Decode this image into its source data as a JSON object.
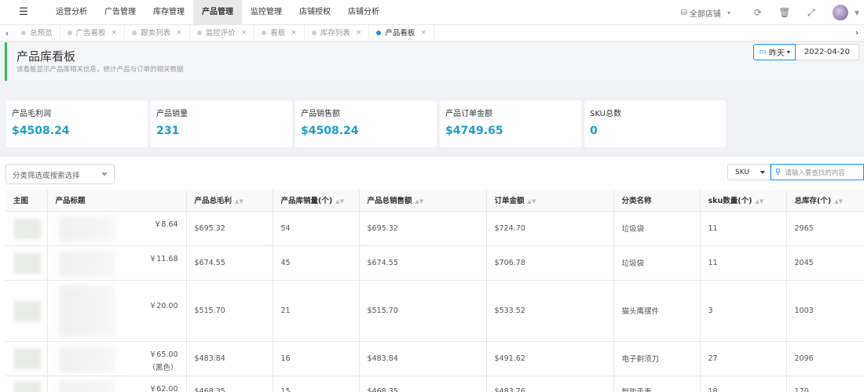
{
  "nav": {
    "items": [
      "运营分析",
      "广告管理",
      "库存管理",
      "产品管理",
      "监控管理",
      "店铺授权",
      "店铺分析"
    ],
    "active_index": 3,
    "store_selector": "全部店铺"
  },
  "tabs": {
    "items": [
      {
        "label": "总预览",
        "closable": false,
        "active": false
      },
      {
        "label": "广告看板",
        "closable": true,
        "active": false
      },
      {
        "label": "跟卖列表",
        "closable": true,
        "active": false
      },
      {
        "label": "监控评价",
        "closable": true,
        "active": false
      },
      {
        "label": "看板",
        "closable": true,
        "active": false
      },
      {
        "label": "库存列表",
        "closable": true,
        "active": false
      },
      {
        "label": "产品看板",
        "closable": true,
        "active": true
      }
    ]
  },
  "page": {
    "title": "产品库看板",
    "description": "该看板显示产品库相关信息，统计产品与订单的相关数据",
    "date_range": "昨天",
    "date_value": "2022-04-20"
  },
  "metrics": [
    {
      "label": "产品毛利润",
      "value": "$4508.24"
    },
    {
      "label": "产品销量",
      "value": "231"
    },
    {
      "label": "产品销售额",
      "value": "$4508.24"
    },
    {
      "label": "产品订单金额",
      "value": "$4749.65"
    },
    {
      "label": "SKU总数",
      "value": "0"
    }
  ],
  "filters": {
    "category_placeholder": "分类筛选或搜索选择",
    "search_type": "SKU",
    "search_placeholder": "请输入要查找的内容"
  },
  "table": {
    "columns": [
      "主图",
      "产品标题",
      "产品总毛利",
      "产品库销量(个)",
      "产品总销售额",
      "订单金额",
      "分类名称",
      "sku数量(个)",
      "总库存(个)"
    ],
    "sortable": [
      false,
      false,
      true,
      true,
      true,
      true,
      false,
      true,
      true
    ],
    "rows": [
      {
        "price": "￥8.64",
        "sub": "",
        "profit": "$695.32",
        "sales": "54",
        "revenue": "$695.32",
        "order": "$724.70",
        "category": "垃圾袋",
        "sku": "11",
        "stock": "2965"
      },
      {
        "price": "￥11.68",
        "sub": "",
        "profit": "$674.55",
        "sales": "45",
        "revenue": "$674.55",
        "order": "$706.78",
        "category": "垃圾袋",
        "sku": "11",
        "stock": "2045"
      },
      {
        "price": "￥20.00",
        "sub": "",
        "profit": "$515.70",
        "sales": "21",
        "revenue": "$515.70",
        "order": "$533.52",
        "category": "猫头鹰摆件",
        "sku": "3",
        "stock": "1003"
      },
      {
        "price": "￥65.00",
        "sub": "（黑色）",
        "profit": "$483.84",
        "sales": "16",
        "revenue": "$483.84",
        "order": "$491.62",
        "category": "电子剃须刀",
        "sku": "27",
        "stock": "2096"
      },
      {
        "price": "￥62.00",
        "sub": "",
        "profit": "$468.35",
        "sales": "15",
        "revenue": "$468.35",
        "order": "$483.76",
        "category": "智能手表",
        "sku": "18",
        "stock": "170"
      }
    ]
  }
}
